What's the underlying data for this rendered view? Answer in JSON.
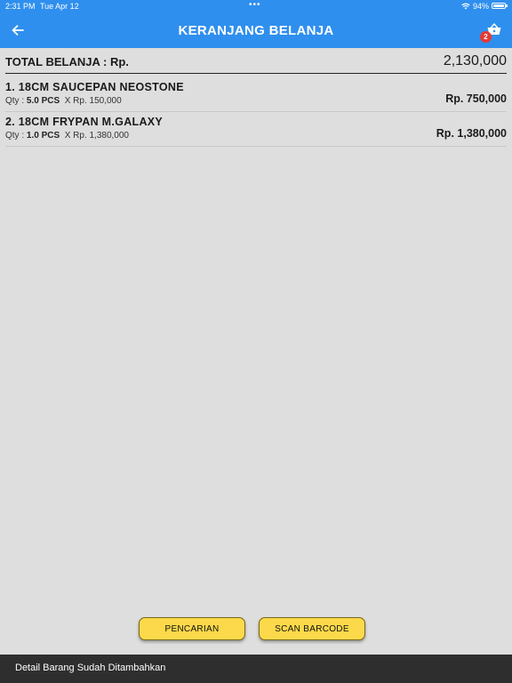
{
  "status_bar": {
    "time": "2:31 PM",
    "date": "Tue Apr 12",
    "battery": "94%"
  },
  "header": {
    "title": "KERANJANG BELANJA",
    "cart_badge": "2",
    "color": "#2f8fee"
  },
  "total": {
    "label": "TOTAL BELANJA : Rp.",
    "value": "2,130,000"
  },
  "items": [
    {
      "name": "1. 18CM SAUCEPAN NEOSTONE",
      "qty_label": "Qty :",
      "qty_value": "5.0 PCS",
      "unit_price": "X Rp. 150,000",
      "subtotal": "Rp. 750,000"
    },
    {
      "name": "2. 18CM FRYPAN M.GALAXY",
      "qty_label": "Qty :",
      "qty_value": "1.0 PCS",
      "unit_price": "X Rp. 1,380,000",
      "subtotal": "Rp. 1,380,000"
    }
  ],
  "buttons": {
    "search": "PENCARIAN",
    "scan": "SCAN BARCODE",
    "color": "#fcd94a"
  },
  "snackbar": {
    "message": "Detail Barang Sudah Ditambahkan"
  },
  "icons": {
    "back": "arrow-left-icon",
    "cart": "shopping-basket-icon",
    "wifi": "wifi-icon",
    "battery": "battery-icon"
  }
}
